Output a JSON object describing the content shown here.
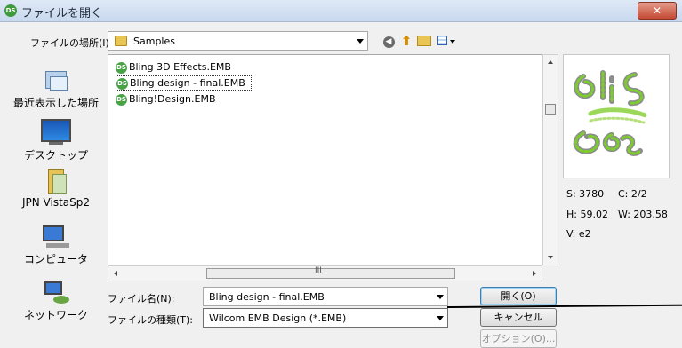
{
  "window": {
    "title": "ファイルを開く",
    "app_icon": "DS",
    "close_label": "✕"
  },
  "lookin": {
    "label": "ファイルの場所(I):",
    "value": "Samples"
  },
  "toolbar": {
    "back_icon": "back-arrow-icon",
    "up_icon": "folder-up-icon",
    "new_folder_icon": "new-folder-icon",
    "view_icon": "view-menu-icon"
  },
  "places": [
    {
      "label": "最近表示した場所",
      "icon": "recent-places-icon"
    },
    {
      "label": "デスクトップ",
      "icon": "desktop-icon"
    },
    {
      "label": "JPN VistaSp2",
      "icon": "user-documents-icon"
    },
    {
      "label": "コンピュータ",
      "icon": "computer-icon"
    },
    {
      "label": "ネットワーク",
      "icon": "network-icon"
    }
  ],
  "files": [
    {
      "name": "Bling 3D Effects.EMB",
      "icon": "DS",
      "selected": false
    },
    {
      "name": "Bling design - final.EMB",
      "icon": "DS",
      "selected": true
    },
    {
      "name": "Bling!Design.EMB",
      "icon": "DS",
      "selected": false
    }
  ],
  "hscroll_grip": "III",
  "preview": {
    "stats": {
      "s": "S: 3780",
      "c": "C: 2/2",
      "h": "H: 59.02",
      "w": "W: 203.58",
      "v": "V: e2"
    }
  },
  "filename": {
    "label": "ファイル名(N):",
    "value": "Bling design - final.EMB"
  },
  "filetype": {
    "label": "ファイルの種類(T):",
    "value": "Wilcom EMB Design (*.EMB)"
  },
  "buttons": {
    "open": "開く(O)",
    "cancel": "キャンセル",
    "options": "オプション(O)..."
  },
  "colors": {
    "brand_green": "#4aa247",
    "title_gradient_top": "#dfe9f6",
    "close_red": "#c44a33"
  }
}
